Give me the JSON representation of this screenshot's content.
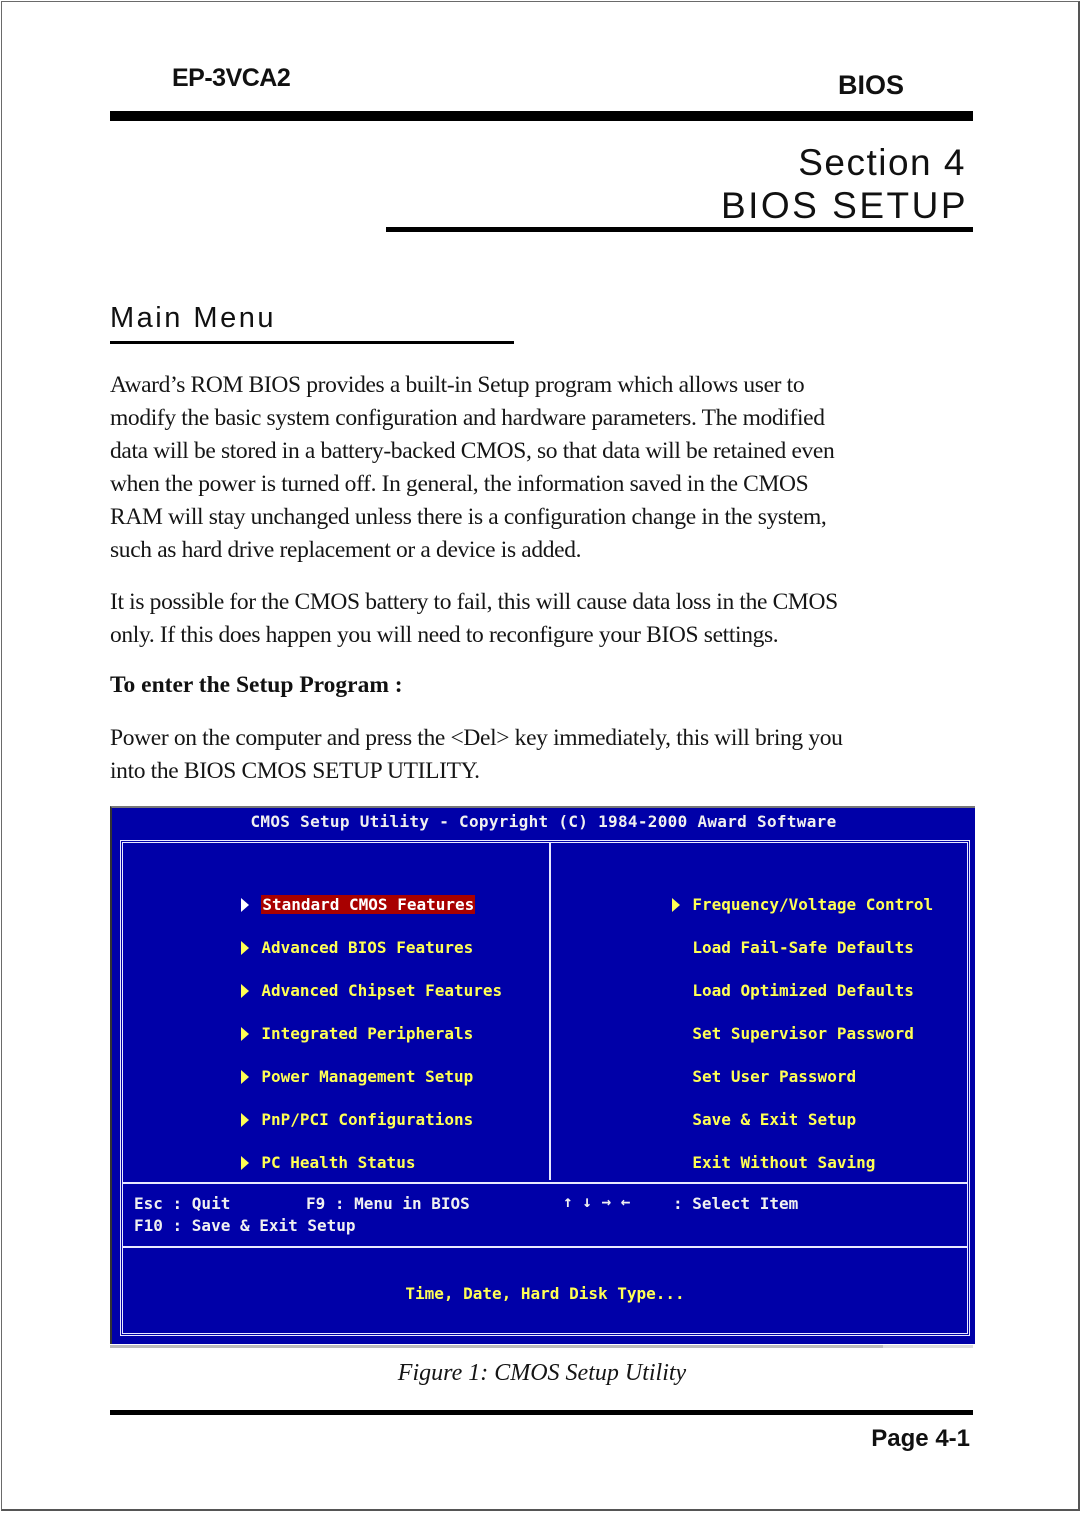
{
  "header": {
    "model": "EP-3VCA2",
    "chapter": "BIOS"
  },
  "section": {
    "number_label": "Section 4",
    "title": "BIOS SETUP"
  },
  "main_menu": {
    "heading": "Main Menu",
    "paragraph1_lines": [
      "Award’s ROM BIOS provides a built-in Setup program which allows user to",
      "modify the basic system configuration and hardware parameters. The modified",
      "data will be stored in a battery-backed CMOS, so that data will be retained even",
      "when the power is turned off. In general, the information saved in the CMOS",
      "RAM will stay unchanged unless there is a configuration change in the system,",
      "such as hard drive replacement or a device is added."
    ],
    "paragraph2_lines": [
      "It is possible for the CMOS battery to fail, this will cause data loss in the CMOS",
      "only. If this does happen you will need to reconfigure your BIOS settings."
    ],
    "subheading": "To enter the Setup Program :",
    "paragraph3_lines": [
      "Power on the computer and press the <Del> key immediately, this will bring you",
      "into the BIOS CMOS SETUP UTILITY."
    ]
  },
  "bios_screen": {
    "title": "CMOS Setup Utility - Copyright (C) 1984-2000 Award Software",
    "left_menu": [
      {
        "label": "Standard CMOS Features",
        "submenu": true,
        "selected": true
      },
      {
        "label": "Advanced BIOS Features",
        "submenu": true
      },
      {
        "label": "Advanced Chipset Features",
        "submenu": true
      },
      {
        "label": "Integrated Peripherals",
        "submenu": true
      },
      {
        "label": "Power Management Setup",
        "submenu": true
      },
      {
        "label": "PnP/PCI Configurations",
        "submenu": true
      },
      {
        "label": "PC Health Status",
        "submenu": true
      }
    ],
    "right_menu": [
      {
        "label": "Frequency/Voltage Control",
        "submenu": true
      },
      {
        "label": "Load Fail-Safe Defaults",
        "submenu": false
      },
      {
        "label": "Load Optimized Defaults",
        "submenu": false
      },
      {
        "label": "Set Supervisor Password",
        "submenu": false
      },
      {
        "label": "Set User Password",
        "submenu": false
      },
      {
        "label": "Save & Exit Setup",
        "submenu": false
      },
      {
        "label": "Exit Without Saving",
        "submenu": false
      }
    ],
    "keys": {
      "esc": "Esc : Quit",
      "f9": "F9 : Menu in BIOS",
      "arrows": "↑ ↓ → ←",
      "select": ": Select Item",
      "f10": "F10 : Save & Exit Setup"
    },
    "help_text": "Time, Date, Hard Disk Type...",
    "colors": {
      "background": "#0000a8",
      "item_text": "#ffff54",
      "highlight": "#a80000",
      "frame": "#e8e8ff"
    }
  },
  "figure_caption": "Figure 1:  CMOS Setup Utility",
  "footer": {
    "page_label": "Page 4-1"
  }
}
